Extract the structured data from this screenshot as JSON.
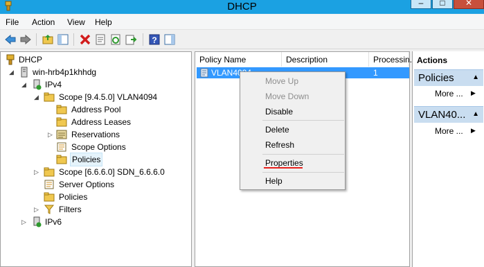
{
  "window": {
    "title": "DHCP",
    "minimize": "–",
    "maximize": "□",
    "close": "✕"
  },
  "menubar": {
    "items": [
      "File",
      "Action",
      "View",
      "Help"
    ]
  },
  "toolbar": {
    "icons": [
      "back-arrow-icon",
      "forward-arrow-icon",
      "up-folder-icon",
      "show-hide-tree-icon",
      "delete-icon",
      "properties-icon",
      "refresh-icon",
      "export-list-icon",
      "help-icon",
      "show-hide-action-pane-icon"
    ]
  },
  "tree": {
    "items": [
      {
        "label": "DHCP",
        "icon": "dhcp-icon",
        "twisty": ""
      },
      {
        "label": "win-hrb4p1khhdg",
        "icon": "server-icon",
        "twisty": "◢"
      },
      {
        "label": "IPv4",
        "icon": "ipv4-icon",
        "twisty": "◢"
      },
      {
        "label": "Scope [9.4.5.0] VLAN4094",
        "icon": "folder-icon",
        "twisty": "◢"
      },
      {
        "label": "Address Pool",
        "icon": "address-pool-icon",
        "twisty": ""
      },
      {
        "label": "Address Leases",
        "icon": "address-leases-icon",
        "twisty": ""
      },
      {
        "label": "Reservations",
        "icon": "reservations-icon",
        "twisty": "▷"
      },
      {
        "label": "Scope Options",
        "icon": "scope-options-icon",
        "twisty": ""
      },
      {
        "label": "Policies",
        "icon": "policies-icon",
        "twisty": ""
      },
      {
        "label": "Scope [6.6.6.0] SDN_6.6.6.0",
        "icon": "folder-icon",
        "twisty": "▷"
      },
      {
        "label": "Server Options",
        "icon": "server-options-icon",
        "twisty": ""
      },
      {
        "label": "Policies",
        "icon": "policies-icon",
        "twisty": ""
      },
      {
        "label": "Filters",
        "icon": "filter-icon",
        "twisty": "▷"
      },
      {
        "label": "IPv6",
        "icon": "ipv6-icon",
        "twisty": "▷"
      }
    ]
  },
  "list": {
    "columns": [
      "Policy Name",
      "Description",
      "Processin."
    ],
    "rows": [
      {
        "name": "VLAN4094",
        "description": "",
        "processing": "1"
      }
    ]
  },
  "context_menu": {
    "items": [
      {
        "label": "Move Up",
        "disabled": true
      },
      {
        "label": "Move Down",
        "disabled": true
      },
      {
        "label": "Disable",
        "disabled": false
      },
      {
        "label": "Delete",
        "disabled": false
      },
      {
        "label": "Refresh",
        "disabled": false
      },
      {
        "label": "Properties",
        "disabled": false
      },
      {
        "label": "Help",
        "disabled": false
      }
    ]
  },
  "actions": {
    "title": "Actions",
    "sections": [
      {
        "name": "Policies",
        "more": "More ..."
      },
      {
        "name": "VLAN40...",
        "more": "More ..."
      }
    ]
  },
  "colors": {
    "title_bar": "#1ba1e2",
    "selection": "#3399ff",
    "action_header": "#c9ddf0",
    "highlight_underline": "#e8201c"
  }
}
